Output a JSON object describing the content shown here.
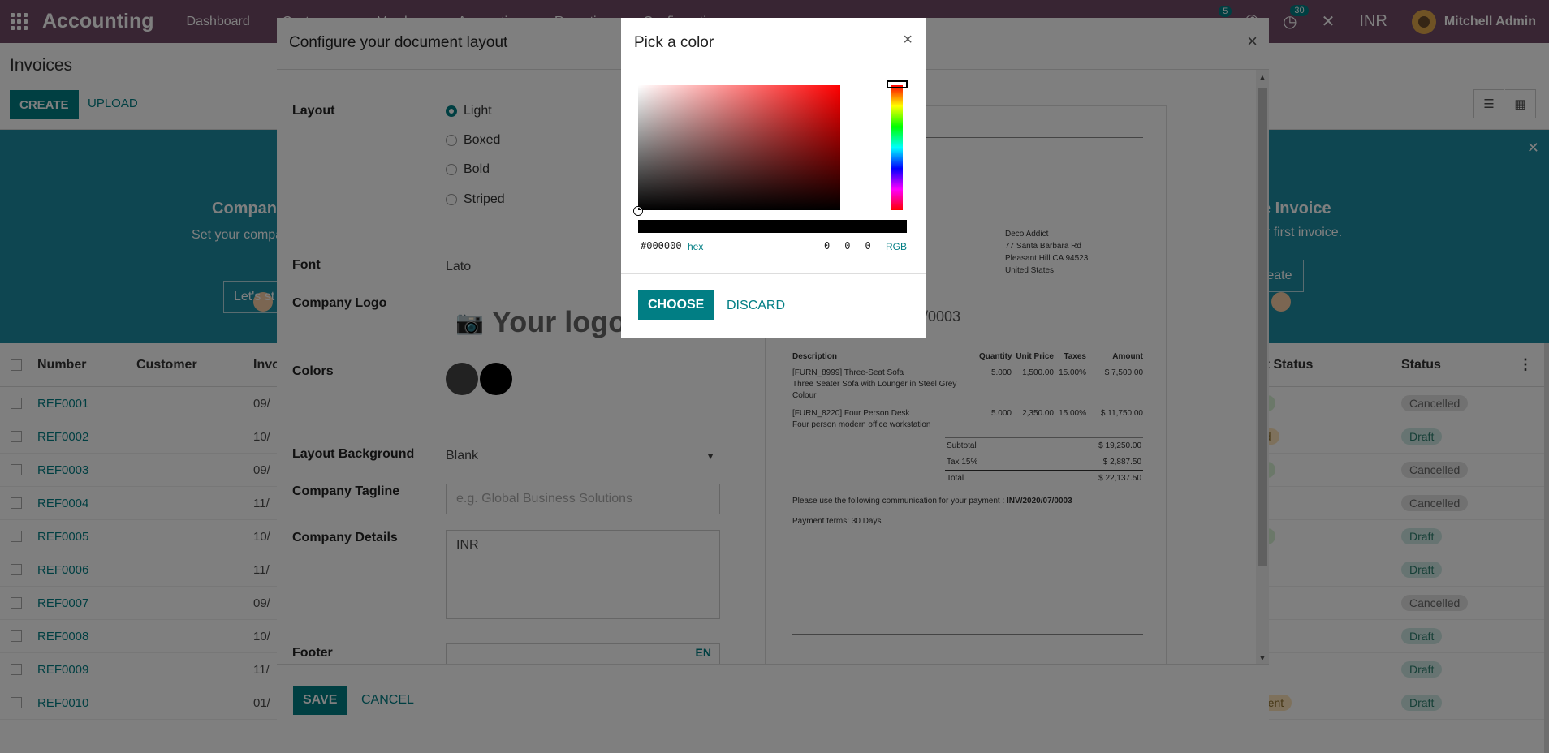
{
  "nav": {
    "brand": "Accounting",
    "menu": [
      "Dashboard",
      "Customers",
      "Vendors",
      "Accounting",
      "Reporting",
      "Configuration"
    ],
    "chat_count": "5",
    "activity_count": "30",
    "currency": "INR",
    "user": "Mitchell Admin"
  },
  "control_panel": {
    "breadcrumb": "Invoices",
    "create_label": "CREATE",
    "upload_label": "UPLOAD"
  },
  "banner": {
    "left_title": "Company",
    "left_text": "Set your compa documents hea",
    "left_button": "Let's st",
    "right_title": "e Invoice",
    "right_text": "ur first invoice.",
    "right_button": "reate"
  },
  "list": {
    "headers": [
      "Number",
      "Customer",
      "Invo",
      "ent Status",
      "Status"
    ],
    "rows": [
      {
        "number": "REF0001",
        "date": "09/",
        "payment": "id",
        "status": "Cancelled",
        "pay_type": "paid",
        "status_type": "cancel"
      },
      {
        "number": "REF0002",
        "date": "10/",
        "payment": "ed",
        "status": "Draft",
        "pay_type": "pay",
        "status_type": "draft"
      },
      {
        "number": "REF0003",
        "date": "09/",
        "payment": "id",
        "status": "Cancelled",
        "pay_type": "paid",
        "status_type": "cancel"
      },
      {
        "number": "REF0004",
        "date": "11/",
        "payment": "",
        "status": "Cancelled",
        "pay_type": "",
        "status_type": "cancel"
      },
      {
        "number": "REF0005",
        "date": "10/",
        "payment": "id",
        "status": "Draft",
        "pay_type": "paid",
        "status_type": "draft"
      },
      {
        "number": "REF0006",
        "date": "11/",
        "payment": "",
        "status": "Draft",
        "pay_type": "",
        "status_type": "draft"
      },
      {
        "number": "REF0007",
        "date": "09/",
        "payment": "",
        "status": "Cancelled",
        "pay_type": "",
        "status_type": "cancel"
      },
      {
        "number": "REF0008",
        "date": "10/",
        "payment": "",
        "status": "Draft",
        "pay_type": "",
        "status_type": "draft"
      },
      {
        "number": "REF0009",
        "date": "11/",
        "payment": "",
        "status": "Draft",
        "pay_type": "",
        "status_type": "draft"
      },
      {
        "number": "REF0010",
        "date": "01/",
        "payment": "ment",
        "status": "Draft",
        "pay_type": "pay",
        "status_type": "draft"
      }
    ]
  },
  "dialog": {
    "title": "Configure your document layout",
    "labels": {
      "layout": "Layout",
      "font": "Font",
      "logo": "Company Logo",
      "colors": "Colors",
      "background": "Layout Background",
      "tagline": "Company Tagline",
      "details": "Company Details",
      "footer": "Footer"
    },
    "layouts": [
      "Light",
      "Boxed",
      "Bold",
      "Striped"
    ],
    "selected_layout": "Light",
    "font_value": "Lato",
    "logo_placeholder": "Your logo",
    "primary_color": "#454545",
    "secondary_color": "#000000",
    "background_value": "Blank",
    "tagline_placeholder": "e.g. Global Business Solutions",
    "details_value": "INR",
    "footer_lang": "EN",
    "save_label": "SAVE",
    "cancel_label": "CANCEL"
  },
  "preview": {
    "address": [
      "Deco Addict",
      "77 Santa Barbara Rd",
      "Pleasant Hill CA 94523",
      "United States"
    ],
    "invoice_number": "/0003",
    "table_headers": [
      "Description",
      "Quantity",
      "Unit Price",
      "Taxes",
      "Amount"
    ],
    "lines": [
      {
        "desc1": "[FURN_8999] Three-Seat Sofa",
        "desc2": "Three Seater Sofa with Lounger in Steel Grey Colour",
        "qty": "5.000",
        "price": "1,500.00",
        "tax": "15.00%",
        "amount": "$ 7,500.00"
      },
      {
        "desc1": "[FURN_8220] Four Person Desk",
        "desc2": "Four person modern office workstation",
        "qty": "5.000",
        "price": "2,350.00",
        "tax": "15.00%",
        "amount": "$ 11,750.00"
      }
    ],
    "totals": [
      {
        "label": "Subtotal",
        "value": "$ 19,250.00"
      },
      {
        "label": "Tax 15%",
        "value": "$ 2,887.50"
      },
      {
        "label": "Total",
        "value": "$ 22,137.50"
      }
    ],
    "communication_text": "Please use the following communication for your payment : ",
    "communication_ref": "INV/2020/07/0003",
    "payment_terms": "Payment terms: 30 Days"
  },
  "picker": {
    "title": "Pick a color",
    "hex_value": "#000000",
    "hex_label": "hex",
    "r": "0",
    "g": "0",
    "b": "0",
    "rgb_label": "RGB",
    "choose_label": "CHOOSE",
    "discard_label": "DISCARD"
  }
}
